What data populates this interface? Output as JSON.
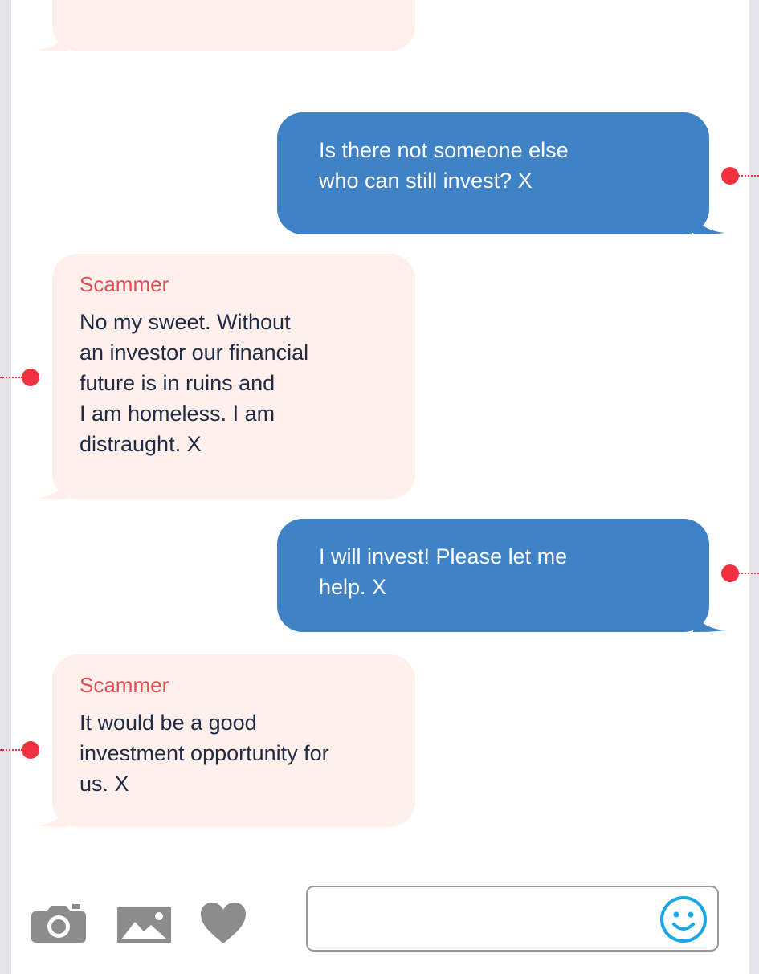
{
  "messages": [
    {
      "id": "m0",
      "direction": "received",
      "sender": "",
      "text": ""
    },
    {
      "id": "m1",
      "direction": "sent",
      "text": "Is there not someone else\nwho can still invest? X"
    },
    {
      "id": "m2",
      "direction": "received",
      "sender": "Scammer",
      "text": "No my sweet. Without\nan investor our financial\nfuture is in ruins and\nI am homeless. I am\ndistraught. X"
    },
    {
      "id": "m3",
      "direction": "sent",
      "text": "I will invest! Please let me\nhelp. X"
    },
    {
      "id": "m4",
      "direction": "received",
      "sender": "Scammer",
      "text": "It would be a good\ninvestment opportunity for\nus. X"
    }
  ],
  "composer": {
    "input_value": "",
    "input_placeholder": "",
    "icons": [
      "camera-icon",
      "image-icon",
      "heart-icon",
      "emoji-icon"
    ]
  },
  "colors": {
    "sent_bubble": "#3f82c6",
    "received_bubble": "#fff0ec",
    "sender_name": "#e24b55",
    "marker": "#f2333f",
    "emoji": "#1aa7e6",
    "icon_gray": "#8c8c8c"
  }
}
